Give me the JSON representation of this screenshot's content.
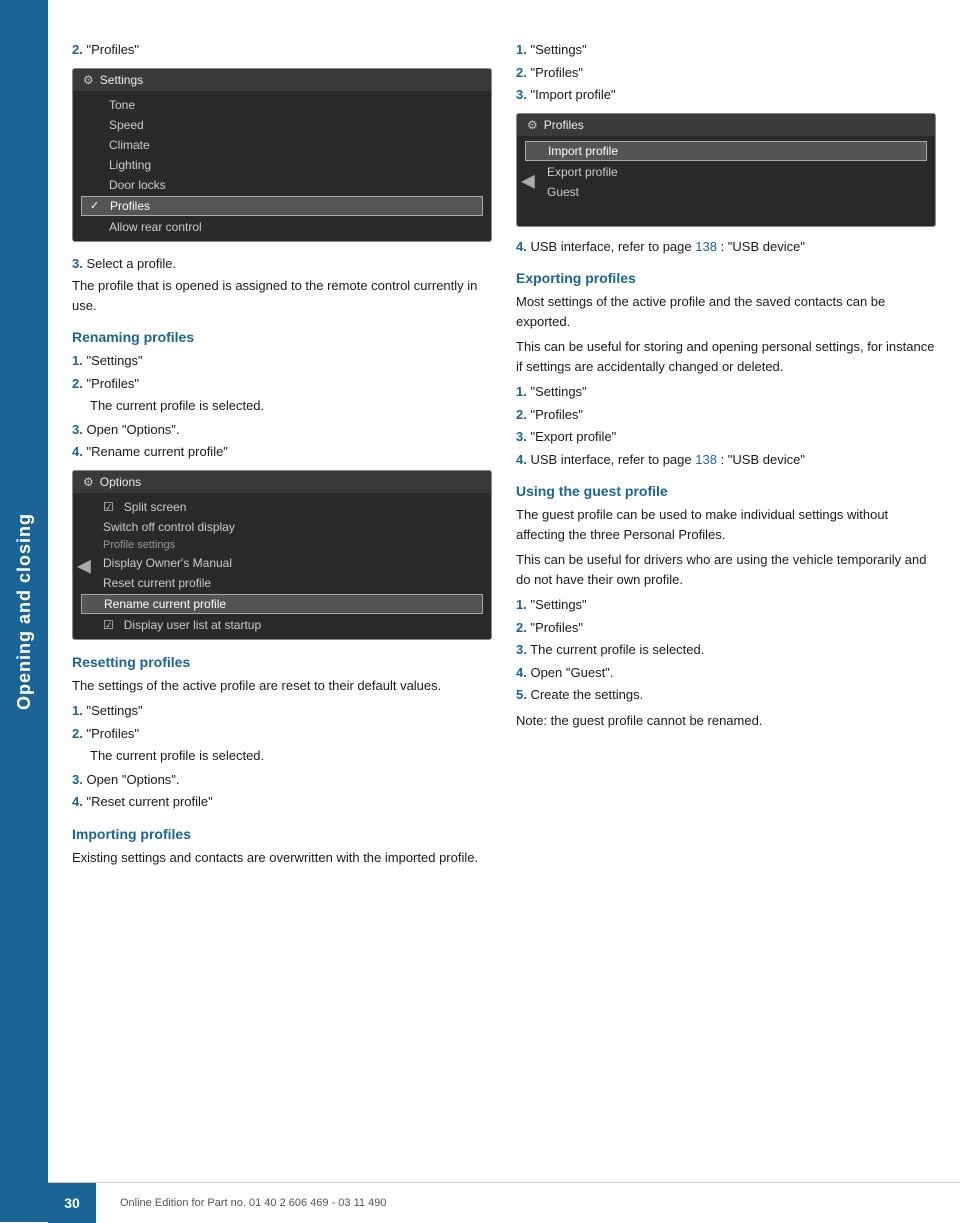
{
  "sidebar": {
    "label": "Opening and closing"
  },
  "page": {
    "number": "30",
    "footer": "Online Edition for Part no. 01 40 2 606 469 - 03 11 490"
  },
  "left_col": {
    "intro_step": {
      "num": "2.",
      "text": "\"Profiles\""
    },
    "settings_screenshot": {
      "title": "Settings",
      "items": [
        {
          "label": "Tone",
          "selected": false
        },
        {
          "label": "Speed",
          "selected": false
        },
        {
          "label": "Climate",
          "selected": false
        },
        {
          "label": "Lighting",
          "selected": false
        },
        {
          "label": "Door locks",
          "selected": false
        },
        {
          "label": "Profiles",
          "selected": true,
          "checked": true
        },
        {
          "label": "Allow rear control",
          "selected": false
        }
      ]
    },
    "step3": {
      "num": "3.",
      "text": "Select a profile."
    },
    "profile_note": "The profile that is opened is assigned to the remote control currently in use.",
    "renaming": {
      "heading": "Renaming profiles",
      "steps": [
        {
          "num": "1.",
          "text": "\"Settings\""
        },
        {
          "num": "2.",
          "text": "\"Profiles\""
        },
        {
          "indent": "The current profile is selected."
        },
        {
          "num": "3.",
          "text": "Open \"Options\"."
        },
        {
          "num": "4.",
          "text": "\"Rename current profile\""
        }
      ]
    },
    "options_screenshot": {
      "title": "Options",
      "items": [
        {
          "label": "Split screen",
          "type": "checked"
        },
        {
          "label": "Switch off control display",
          "type": "normal"
        },
        {
          "label": "Profile settings",
          "type": "section"
        },
        {
          "label": "Display Owner's Manual",
          "type": "normal"
        },
        {
          "label": "Reset current profile",
          "type": "normal"
        },
        {
          "label": "Rename current profile",
          "type": "highlighted"
        },
        {
          "label": "Display user list at startup",
          "type": "checked"
        }
      ]
    },
    "resetting": {
      "heading": "Resetting profiles",
      "intro": "The settings of the active profile are reset to their default values.",
      "steps": [
        {
          "num": "1.",
          "text": "\"Settings\""
        },
        {
          "num": "2.",
          "text": "\"Profiles\""
        },
        {
          "indent": "The current profile is selected."
        },
        {
          "num": "3.",
          "text": "Open \"Options\"."
        },
        {
          "num": "4.",
          "text": "\"Reset current profile\""
        }
      ]
    },
    "importing": {
      "heading": "Importing profiles",
      "intro": "Existing settings and contacts are overwritten with the imported profile."
    }
  },
  "right_col": {
    "import_steps_top": [
      {
        "num": "1.",
        "text": "\"Settings\""
      },
      {
        "num": "2.",
        "text": "\"Profiles\""
      },
      {
        "num": "3.",
        "text": "\"Import profile\""
      }
    ],
    "profiles_screenshot": {
      "title": "Profiles",
      "items": [
        {
          "label": "Import profile",
          "highlighted": true
        },
        {
          "label": "Export profile",
          "highlighted": false
        },
        {
          "label": "Guest",
          "highlighted": false
        }
      ]
    },
    "import_step4": {
      "num": "4.",
      "text": "USB interface, refer to page ",
      "link": "138",
      "text2": ": \"USB device\""
    },
    "exporting": {
      "heading": "Exporting profiles",
      "para1": "Most settings of the active profile and the saved contacts can be exported.",
      "para2": "This can be useful for storing and opening personal settings, for instance if settings are accidentally changed or deleted.",
      "steps": [
        {
          "num": "1.",
          "text": "\"Settings\""
        },
        {
          "num": "2.",
          "text": "\"Profiles\""
        },
        {
          "num": "3.",
          "text": "\"Export profile\""
        },
        {
          "num": "4.",
          "text_before": "USB interface, refer to page ",
          "link": "138",
          "text_after": ": \"USB device\""
        }
      ]
    },
    "guest": {
      "heading": "Using the guest profile",
      "para1": "The guest profile can be used to make individual settings without affecting the three Personal Profiles.",
      "para2": "This can be useful for drivers who are using the vehicle temporarily and do not have their own profile.",
      "steps": [
        {
          "num": "1.",
          "text": "\"Settings\""
        },
        {
          "num": "2.",
          "text": "\"Profiles\""
        },
        {
          "num": "3.",
          "text": "The current profile is selected."
        },
        {
          "num": "4.",
          "text": "Open \"Guest\"."
        },
        {
          "num": "5.",
          "text": "Create the settings."
        }
      ],
      "note": "Note: the guest profile cannot be renamed."
    }
  }
}
